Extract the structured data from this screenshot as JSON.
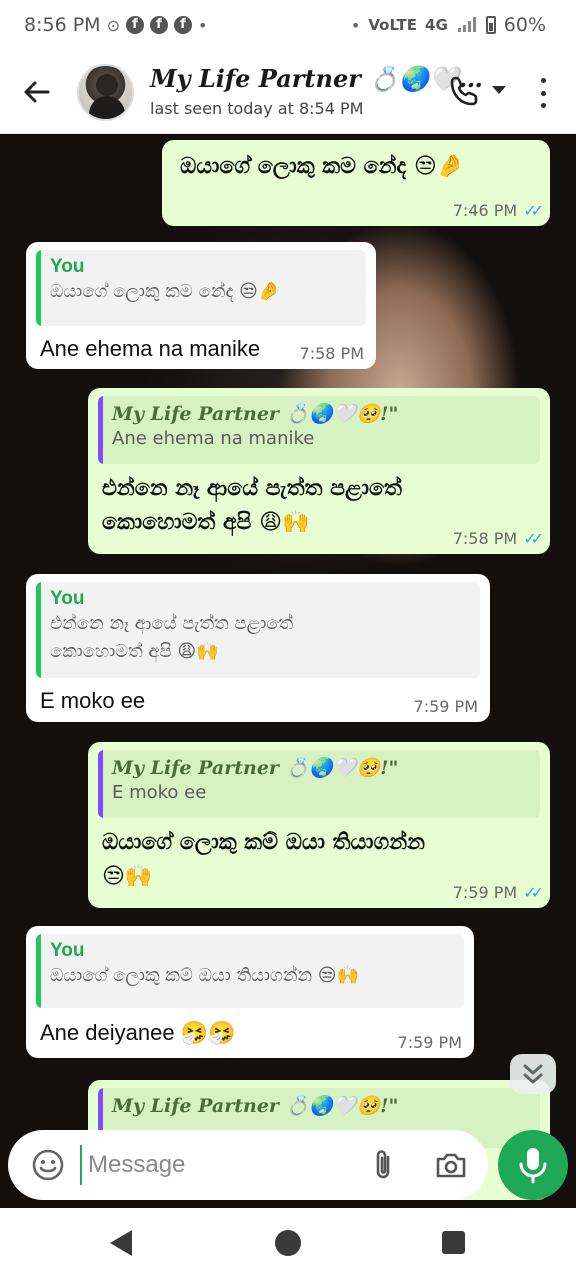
{
  "status_bar": {
    "time": "8:56 PM",
    "network": "VoLTE",
    "signal": "4G",
    "battery": "60%"
  },
  "header": {
    "contact_name": "My Life Partner 💍🌏🤍…",
    "last_seen": "last seen today at 8:54 PM"
  },
  "messages": [
    {
      "direction": "out",
      "text": "ඔයාගේ ලොකු කම නේද 😒🤌",
      "time": "7:46 PM"
    },
    {
      "direction": "in",
      "quote_author": "You",
      "quote_text": "ඔයාගේ ලොකු කම නේද 😒🤌",
      "text": "Ane ehema na manike",
      "time": "7:58 PM"
    },
    {
      "direction": "out",
      "quote_author": "My Life Partner 💍🌏🤍🥺!\"",
      "quote_text": "Ane ehema na manike",
      "text_line1": "එන්නෙ නෑ ආයේ පැත්ත පළාතේ",
      "text_line2": "කොහොමත් අපි 😩🙌",
      "time": "7:58 PM"
    },
    {
      "direction": "in",
      "quote_author": "You",
      "quote_text_line1": "එන්නෙ නෑ ආයේ පැත්ත පළාතේ",
      "quote_text_line2": "කොහොමත් අපි 😩🙌",
      "text": "E moko ee",
      "time": "7:59 PM"
    },
    {
      "direction": "out",
      "quote_author": "My Life Partner 💍🌏🤍🥺!\"",
      "quote_text": "E moko ee",
      "text_line1": "ඔයාගේ ලොකු කම් ඔයා තියාගන්න",
      "text_line2": "😒🙌",
      "time": "7:59 PM"
    },
    {
      "direction": "in",
      "quote_author": "You",
      "quote_text": "ඔයාගේ ලොකු කම් ඔයා තියාගන්න 😒🙌",
      "text": "Ane deiyanee 🤧🤧",
      "time": "7:59 PM"
    },
    {
      "direction": "out",
      "quote_author": "My Life Partner 💍🌏🤍🥺!\""
    }
  ],
  "composer": {
    "placeholder": "Message"
  },
  "colors": {
    "accent_green": "#1fa855",
    "outgoing_bubble": "#e7fdd2",
    "incoming_bubble": "#ffffff",
    "read_ticks": "#39a5e0"
  },
  "icons": [
    "back-arrow-icon",
    "phone-icon",
    "more-vert-icon",
    "emoji-icon",
    "attach-icon",
    "camera-icon",
    "mic-icon",
    "chevron-down-icon"
  ]
}
